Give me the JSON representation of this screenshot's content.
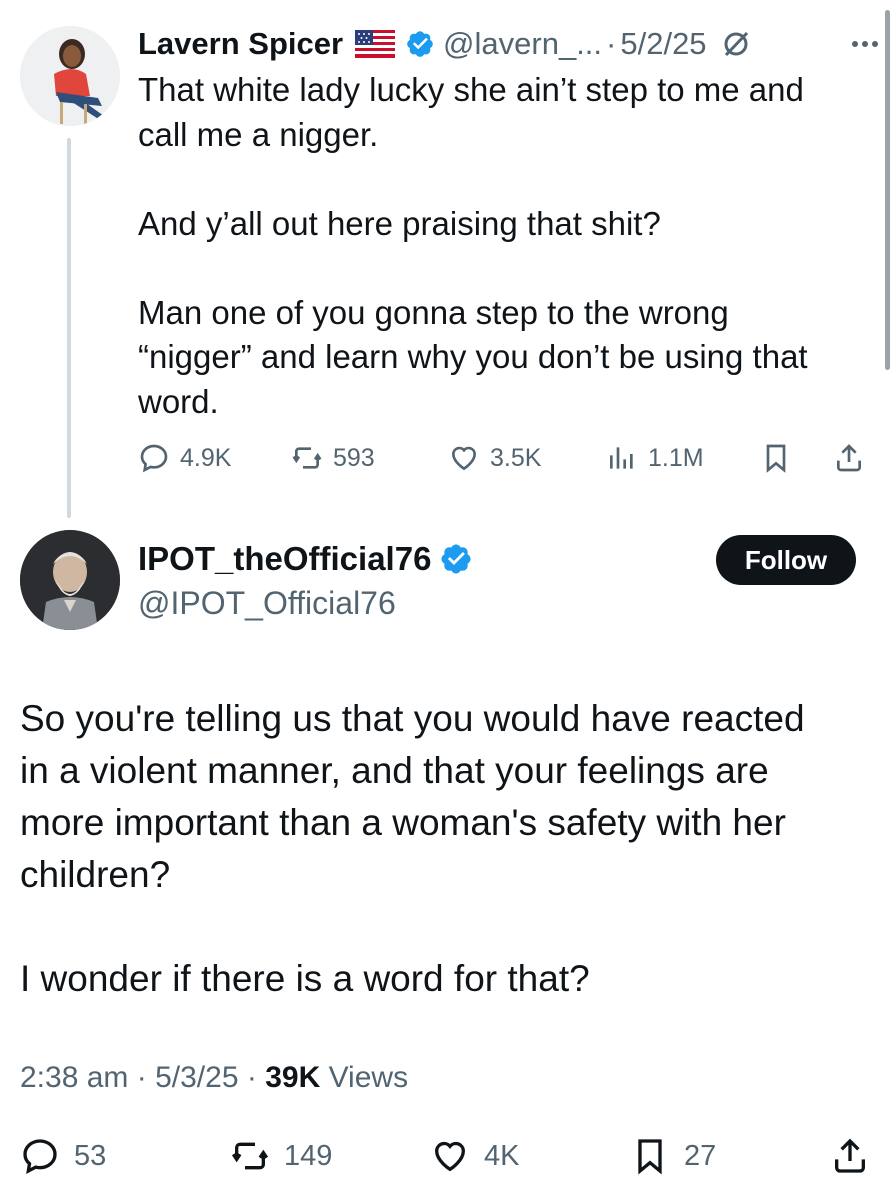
{
  "parent_tweet": {
    "display_name": "Lavern Spicer",
    "flag_icon": "us-flag-icon",
    "handle": "@lavern_...",
    "separator": "·",
    "date": "5/2/25",
    "text": "That white lady lucky she ain’t step to me and\ncall me a nigger.\n\nAnd y’all out here praising that shit?\n\nMan one of you gonna step to the wrong\n“nigger” and learn why you don’t be using that\nword.",
    "replies": "4.9K",
    "reposts": "593",
    "likes": "3.5K",
    "views": "1.1M"
  },
  "reply_tweet": {
    "display_name": "IPOT_theOfficial76",
    "handle": "@IPOT_Official76",
    "follow_label": "Follow",
    "text": "So you're telling us that you would have reacted\nin a violent manner, and that your feelings are\nmore important than a woman's safety with her\nchildren?\n\nI wonder if there is a word for that?",
    "time": "2:38 am",
    "separator": "·",
    "date": "5/3/25",
    "views_count": "39K",
    "views_label": "Views",
    "replies": "53",
    "reposts": "149",
    "likes": "4K",
    "bookmarks": "27"
  },
  "colors": {
    "verified": "#1d9bf0",
    "text": "#0f1419",
    "muted": "#536471",
    "follow_bg": "#0f1419"
  }
}
